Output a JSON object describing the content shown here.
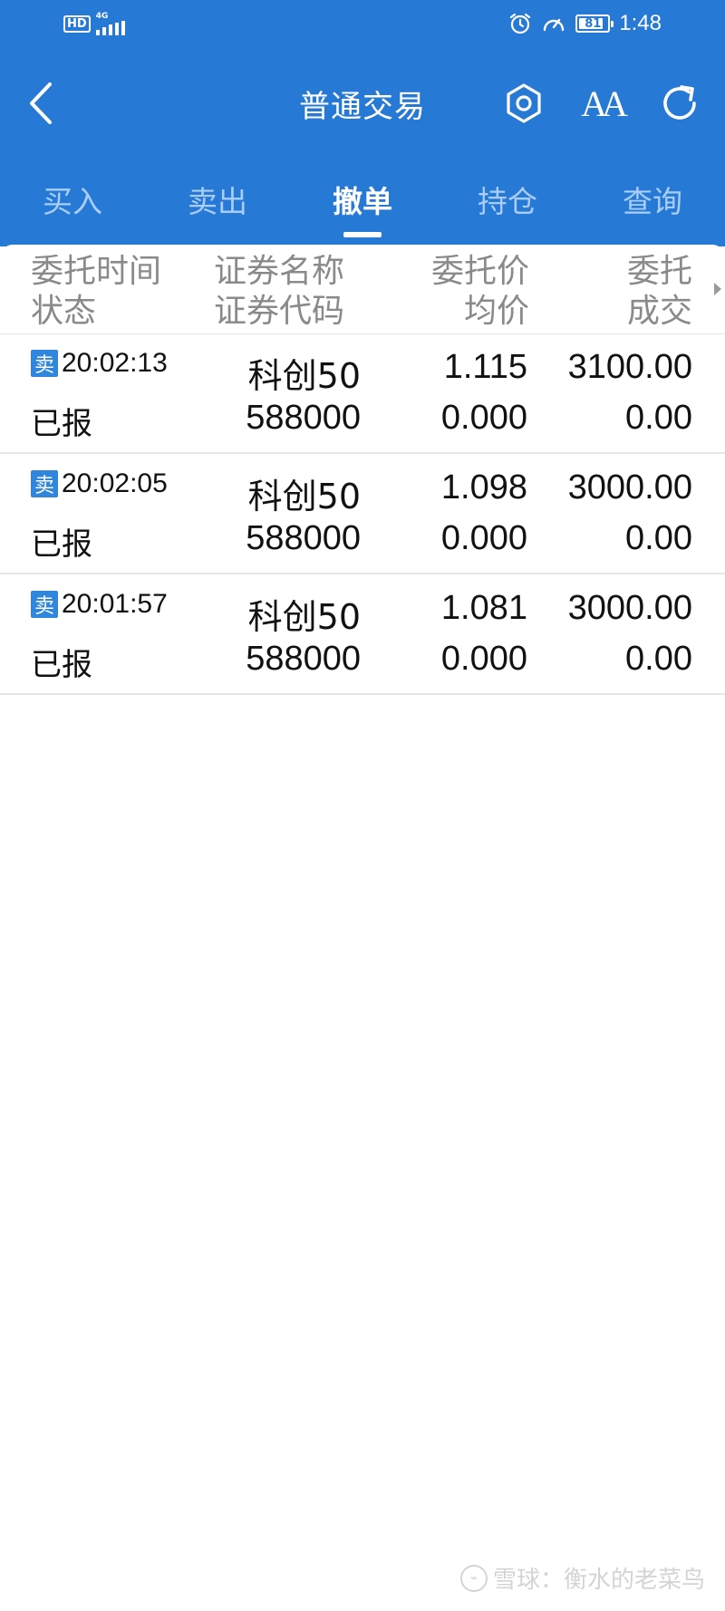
{
  "status_bar": {
    "hd_label": "HD",
    "network_label": "4G",
    "battery": "81",
    "time": "1:48"
  },
  "title_bar": {
    "title": "普通交易",
    "font_icon_text": "AA"
  },
  "tabs": [
    {
      "label": "买入",
      "active": false
    },
    {
      "label": "卖出",
      "active": false
    },
    {
      "label": "撤单",
      "active": true
    },
    {
      "label": "持仓",
      "active": false
    },
    {
      "label": "查询",
      "active": false
    }
  ],
  "table": {
    "columns": [
      {
        "line1": "委托时间",
        "line2": "状态"
      },
      {
        "line1": "证券名称",
        "line2": "证券代码"
      },
      {
        "line1": "委托价",
        "line2": "均价"
      },
      {
        "line1": "委托",
        "line2": "成交"
      }
    ],
    "rows": [
      {
        "side": "卖",
        "time": "20:02:13",
        "status": "已报",
        "name": "科创50",
        "code": "588000",
        "price": "1.115",
        "avg_price": "0.000",
        "order_qty": "3100.00",
        "filled_qty": "0.00"
      },
      {
        "side": "卖",
        "time": "20:02:05",
        "status": "已报",
        "name": "科创50",
        "code": "588000",
        "price": "1.098",
        "avg_price": "0.000",
        "order_qty": "3000.00",
        "filled_qty": "0.00"
      },
      {
        "side": "卖",
        "time": "20:01:57",
        "status": "已报",
        "name": "科创50",
        "code": "588000",
        "price": "1.081",
        "avg_price": "0.000",
        "order_qty": "3000.00",
        "filled_qty": "0.00"
      }
    ]
  },
  "watermark": {
    "text": "雪球：衡水的老菜鸟"
  },
  "colors": {
    "header_blue": "#2779d6",
    "inactive_tab": "#a9cdf5",
    "sell_badge": "#2f86dc"
  }
}
